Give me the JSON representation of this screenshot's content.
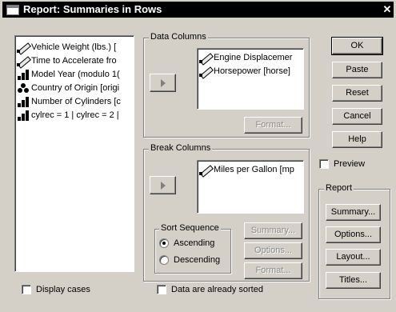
{
  "window": {
    "title": "Report: Summaries in Rows",
    "close_glyph": "✕"
  },
  "variables": [
    {
      "icon": "pencil-icon",
      "label": "Vehicle Weight (lbs.) ["
    },
    {
      "icon": "pencil-icon",
      "label": "Time to Accelerate fro"
    },
    {
      "icon": "bars-icon",
      "label": "Model Year (modulo 1("
    },
    {
      "icon": "balls-icon",
      "label": "Country of Origin [origi"
    },
    {
      "icon": "bars-icon",
      "label": "Number of Cylinders [c"
    },
    {
      "icon": "bars-icon",
      "label": "cylrec = 1 | cylrec = 2 |"
    }
  ],
  "data_columns": {
    "label": "Data Columns",
    "items": [
      {
        "icon": "pencil-icon",
        "label": "Engine Displacemer"
      },
      {
        "icon": "pencil-icon",
        "label": "Horsepower [horse]"
      }
    ],
    "format_button": "Format..."
  },
  "break_columns": {
    "label": "Break Columns",
    "items": [
      {
        "icon": "pencil-icon",
        "label": "Miles per Gallon [mp"
      }
    ],
    "summary_button": "Summary...",
    "options_button": "Options...",
    "format_button": "Format..."
  },
  "sort_sequence": {
    "label": "Sort Sequence",
    "ascending": "Ascending",
    "descending": "Descending",
    "selected": "Ascending"
  },
  "checkboxes": {
    "display_cases": "Display cases",
    "data_sorted": "Data are already sorted",
    "preview": "Preview"
  },
  "buttons": {
    "ok": "OK",
    "paste": "Paste",
    "reset": "Reset",
    "cancel": "Cancel",
    "help": "Help"
  },
  "report": {
    "label": "Report",
    "summary": "Summary...",
    "options": "Options...",
    "layout": "Layout...",
    "titles": "Titles..."
  }
}
